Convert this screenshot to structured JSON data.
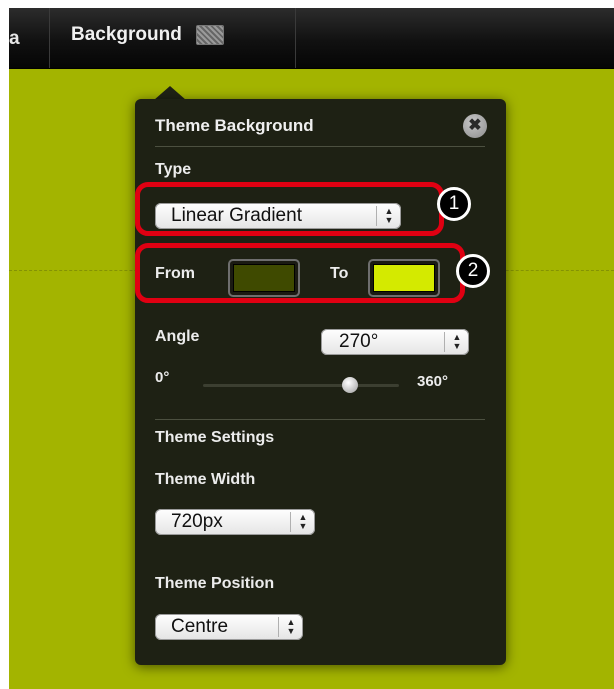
{
  "toolbar": {
    "prev_tab_label": "a",
    "background_tab_label": "Background"
  },
  "panel": {
    "title": "Theme Background",
    "close_symbol": "✖",
    "type": {
      "label": "Type",
      "value": "Linear Gradient"
    },
    "gradient": {
      "from_label": "From",
      "to_label": "To",
      "from_color": "#3f4a00",
      "to_color": "#d4ea00"
    },
    "angle": {
      "label": "Angle",
      "value": "270°",
      "min_label": "0°",
      "max_label": "360°",
      "slider_fraction": 0.75
    },
    "settings_heading": "Theme Settings",
    "width": {
      "label": "Theme Width",
      "value": "720px"
    },
    "position": {
      "label": "Theme Position",
      "value": "Centre"
    }
  },
  "annotations": {
    "badge_1": "1",
    "badge_2": "2",
    "highlight_color": "#e00012"
  },
  "colors": {
    "page_background": "#a3b400",
    "panel_background": "#1e2114"
  },
  "icons": {
    "close": "close-icon",
    "swatch": "background-swatch-icon",
    "select_arrows": "up-down-arrows-icon"
  }
}
